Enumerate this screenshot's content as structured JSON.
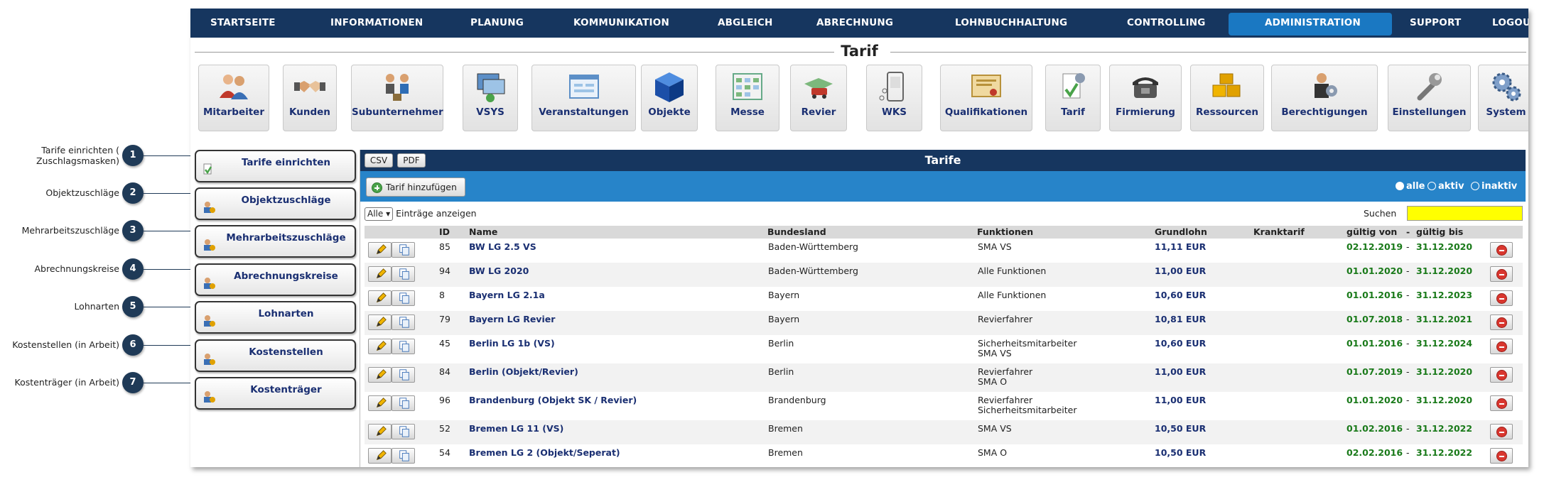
{
  "callouts": [
    {
      "num": "1",
      "label": "Tarife einrichten ( Zuschlagsmasken)"
    },
    {
      "num": "2",
      "label": "Objektzuschläge"
    },
    {
      "num": "3",
      "label": "Mehrarbeitszuschläge"
    },
    {
      "num": "4",
      "label": "Abrechnungskreise"
    },
    {
      "num": "5",
      "label": "Lohnarten"
    },
    {
      "num": "6",
      "label": "Kostenstellen (in Arbeit)"
    },
    {
      "num": "7",
      "label": "Kostenträger (in Arbeit)"
    }
  ],
  "nav": {
    "items": [
      "STARTSEITE",
      "INFORMATIONEN",
      "PLANUNG",
      "KOMMUNIKATION",
      "ABGLEICH",
      "ABRECHNUNG",
      "LOHNBUCHHALTUNG",
      "CONTROLLING",
      "ADMINISTRATION",
      "SUPPORT",
      "LOGOUT"
    ],
    "active": "ADMINISTRATION",
    "active_color": "#1a78c2",
    "bar_color": "#16365f"
  },
  "page_title": "Tarif",
  "modules": [
    {
      "label": "Mitarbeiter",
      "icon": "people-icon"
    },
    {
      "label": "Kunden",
      "icon": "handshake-icon"
    },
    {
      "label": "Subunternehmer",
      "icon": "subcontractor-icon"
    },
    {
      "label": "VSYS",
      "icon": "computer-network-icon"
    },
    {
      "label": "Veranstaltungen",
      "icon": "calendar-window-icon"
    },
    {
      "label": "Objekte",
      "icon": "cube-icon"
    },
    {
      "label": "Messe",
      "icon": "grid-calendar-icon"
    },
    {
      "label": "Revier",
      "icon": "map-car-icon"
    },
    {
      "label": "WKS",
      "icon": "device-icon"
    },
    {
      "label": "Qualifikationen",
      "icon": "certificate-icon"
    },
    {
      "label": "Tarif",
      "icon": "document-gear-icon"
    },
    {
      "label": "Firmierung",
      "icon": "telephone-icon"
    },
    {
      "label": "Ressourcen",
      "icon": "boxes-icon"
    },
    {
      "label": "Berechtigungen",
      "icon": "user-gear-icon"
    },
    {
      "label": "Einstellungen",
      "icon": "wrench-icon"
    },
    {
      "label": "System",
      "icon": "gears-icon"
    }
  ],
  "sidebar": [
    {
      "label": "Tarife einrichten",
      "icon": "tarif-small-icon"
    },
    {
      "label": "Objektzuschläge",
      "icon": "user-small-icon"
    },
    {
      "label": "Mehrarbeitszuschläge",
      "icon": "user-small-icon"
    },
    {
      "label": "Abrechnungskreise",
      "icon": "user-small-icon"
    },
    {
      "label": "Lohnarten",
      "icon": "user-small-icon"
    },
    {
      "label": "Kostenstellen",
      "icon": "user-small-icon"
    },
    {
      "label": "Kostenträger",
      "icon": "user-small-icon"
    }
  ],
  "table": {
    "title": "Tarife",
    "export_buttons": [
      "CSV",
      "PDF"
    ],
    "add_button": "Tarif hinzufügen",
    "filters": [
      "alle",
      "aktiv",
      "inaktiv"
    ],
    "filter_selected": "alle",
    "length_value": "Alle",
    "length_label": "Einträge anzeigen",
    "search_label": "Suchen",
    "search_value": "",
    "columns": [
      "ID",
      "Name",
      "Bundesland",
      "Funktionen",
      "Grundlohn",
      "Kranktarif",
      "gültig von",
      "-",
      "gültig bis"
    ],
    "rows": [
      {
        "id": "85",
        "name": "BW LG 2.5 VS",
        "bundesland": "Baden-Württemberg",
        "funktionen": [
          "SMA VS"
        ],
        "grundlohn": "11,11 EUR",
        "kranktarif": "",
        "von": "02.12.2019",
        "sep": "-",
        "bis": "31.12.2020"
      },
      {
        "id": "94",
        "name": "BW LG 2020",
        "bundesland": "Baden-Württemberg",
        "funktionen": [
          "Alle Funktionen"
        ],
        "grundlohn": "11,00 EUR",
        "kranktarif": "",
        "von": "01.01.2020",
        "sep": "-",
        "bis": "31.12.2020"
      },
      {
        "id": "8",
        "name": "Bayern LG 2.1a",
        "bundesland": "Bayern",
        "funktionen": [
          "Alle Funktionen"
        ],
        "grundlohn": "10,60 EUR",
        "kranktarif": "",
        "von": "01.01.2016",
        "sep": "-",
        "bis": "31.12.2023"
      },
      {
        "id": "79",
        "name": "Bayern LG Revier",
        "bundesland": "Bayern",
        "funktionen": [
          "Revierfahrer"
        ],
        "grundlohn": "10,81 EUR",
        "kranktarif": "",
        "von": "01.07.2018",
        "sep": "-",
        "bis": "31.12.2021"
      },
      {
        "id": "45",
        "name": "Berlin LG 1b (VS)",
        "bundesland": "Berlin",
        "funktionen": [
          "Sicherheitsmitarbeiter",
          "SMA VS"
        ],
        "grundlohn": "10,60 EUR",
        "kranktarif": "",
        "von": "01.01.2016",
        "sep": "-",
        "bis": "31.12.2024"
      },
      {
        "id": "84",
        "name": "Berlin (Objekt/Revier)",
        "bundesland": "Berlin",
        "funktionen": [
          "Revierfahrer",
          "SMA O"
        ],
        "grundlohn": "11,00 EUR",
        "kranktarif": "",
        "von": "01.07.2019",
        "sep": "-",
        "bis": "31.12.2020"
      },
      {
        "id": "96",
        "name": "Brandenburg (Objekt SK / Revier)",
        "bundesland": "Brandenburg",
        "funktionen": [
          "Revierfahrer",
          "Sicherheitsmitarbeiter"
        ],
        "grundlohn": "11,00 EUR",
        "kranktarif": "",
        "von": "01.01.2020",
        "sep": "-",
        "bis": "31.12.2020"
      },
      {
        "id": "52",
        "name": "Bremen LG 11 (VS)",
        "bundesland": "Bremen",
        "funktionen": [
          "SMA VS"
        ],
        "grundlohn": "10,50 EUR",
        "kranktarif": "",
        "von": "01.02.2016",
        "sep": "-",
        "bis": "31.12.2022"
      },
      {
        "id": "54",
        "name": "Bremen LG 2 (Objekt/Seperat)",
        "bundesland": "Bremen",
        "funktionen": [
          "SMA O"
        ],
        "grundlohn": "10,50 EUR",
        "kranktarif": "",
        "von": "02.02.2016",
        "sep": "-",
        "bis": "31.12.2022"
      }
    ]
  }
}
